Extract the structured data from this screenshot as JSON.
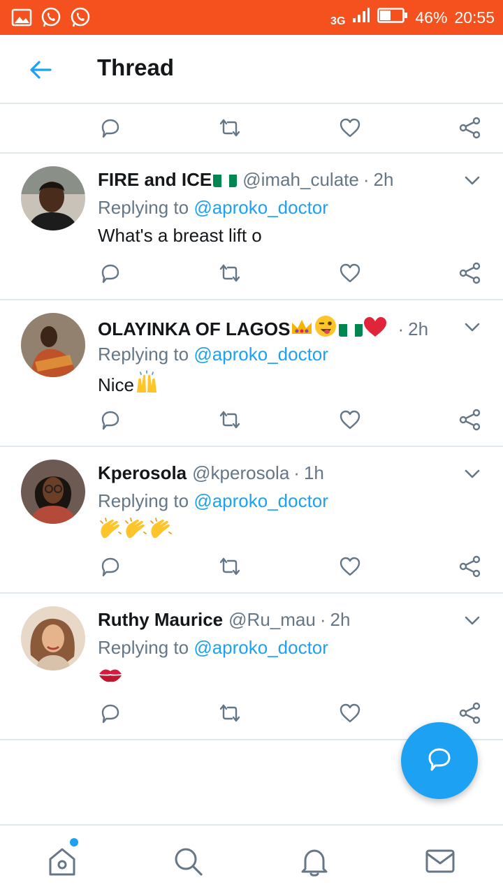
{
  "statusbar": {
    "network": "3G",
    "battery": "46%",
    "time": "20:55",
    "icons": [
      "gallery-icon",
      "whatsapp-icon",
      "whatsapp-icon"
    ]
  },
  "header": {
    "title": "Thread",
    "back_icon": "arrow-left-icon"
  },
  "tweets": [
    {
      "name": "FIRE and ICE",
      "handle": "@imah_culate",
      "time": "2h",
      "replying_prefix": "Replying to",
      "replying_to": "@aproko_doctor",
      "text": "What's a breast lift o"
    },
    {
      "name": "OLAYINKA OF LAGOS",
      "handle": "",
      "time": "2h",
      "replying_prefix": "Replying to",
      "replying_to": "@aproko_doctor",
      "text": "Nice"
    },
    {
      "name": "Kperosola",
      "handle": "@kperosola",
      "time": "1h",
      "replying_prefix": "Replying to",
      "replying_to": "@aproko_doctor",
      "text": ""
    },
    {
      "name": "Ruthy Maurice",
      "handle": "@Ru_mau",
      "time": "2h",
      "replying_prefix": "Replying to",
      "replying_to": "@aproko_doctor",
      "text": ""
    }
  ],
  "bottom_nav": [
    "home-icon",
    "search-icon",
    "bell-icon",
    "mail-icon"
  ],
  "colors": {
    "statusbar": "#f4511e",
    "accent": "#1da1f2",
    "text": "#14171a",
    "muted": "#657786",
    "divider": "#e1e8ed"
  }
}
